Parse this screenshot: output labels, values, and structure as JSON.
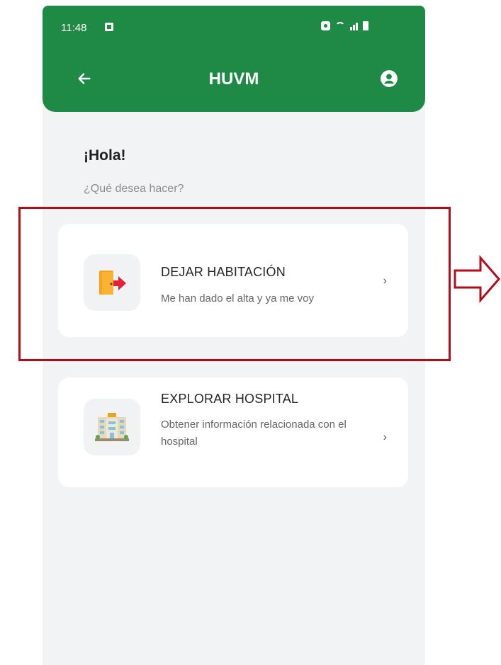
{
  "status_bar": {
    "time": "11:48"
  },
  "app_bar": {
    "title": "HUVM"
  },
  "greeting": {
    "title": "¡Hola!",
    "subtitle": "¿Qué desea hacer?"
  },
  "options": [
    {
      "title": "DEJAR HABITACIÓN",
      "description": "Me han dado el alta y ya me voy",
      "icon": "exit-door-icon"
    },
    {
      "title": "EXPLORAR HOSPITAL",
      "description": "Obtener información relacionada con el hospital",
      "icon": "hospital-building-icon"
    }
  ],
  "colors": {
    "primary": "#1e8a45",
    "background": "#f2f3f5",
    "annotation": "#b00d1b"
  }
}
